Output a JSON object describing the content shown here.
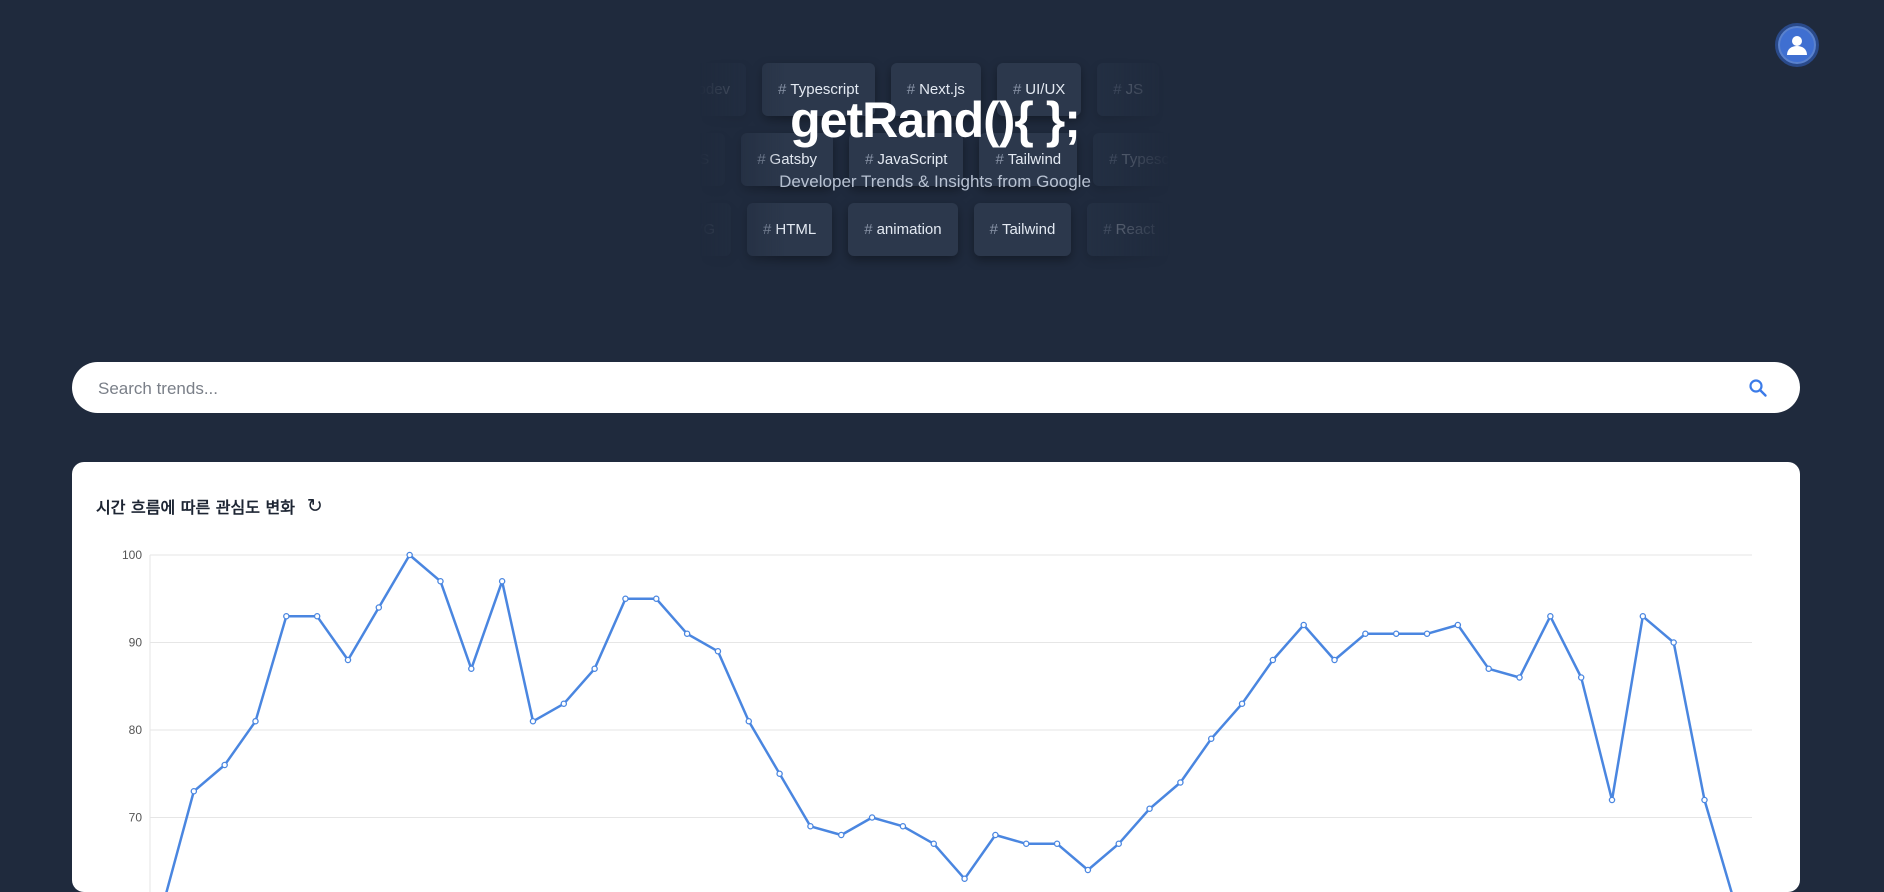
{
  "header": {
    "avatar_icon": "user-icon"
  },
  "hero": {
    "title": "getRand(){ };",
    "subtitle": "Developer Trends & Insights from Google",
    "rows": [
      {
        "offset": -50,
        "tags": [
          "webdev",
          "Typescript",
          "Next.js",
          "UI/UX",
          "JS"
        ]
      },
      {
        "offset": -50,
        "tags": [
          "CSS",
          "Gatsby",
          "JavaScript",
          "Tailwind",
          "Typescript"
        ]
      },
      {
        "offset": -45,
        "tags": [
          "SVG",
          "HTML",
          "animation",
          "Tailwind",
          "React"
        ]
      }
    ]
  },
  "search": {
    "placeholder": "Search trends...",
    "icon": "search-icon"
  },
  "colors": {
    "background": "#1f2a3d",
    "accent": "#4a86e0",
    "card": "#ffffff"
  },
  "chart_card": {
    "title": "시간 흐름에 따른 관심도 변화",
    "refresh_icon": "↻"
  },
  "chart_data": {
    "type": "line",
    "title": "시간 흐름에 따른 관심도 변화",
    "xlabel": "",
    "ylabel": "",
    "y_ticks": [
      100,
      90,
      80,
      70
    ],
    "ylim": [
      60,
      100
    ],
    "grid": true,
    "series": [
      {
        "values": [
          60,
          73,
          76,
          81,
          93,
          93,
          88,
          94,
          100,
          97,
          87,
          97,
          81,
          83,
          87,
          95,
          95,
          91,
          89,
          81,
          75,
          69,
          68,
          70,
          69,
          67,
          63,
          68,
          67,
          67,
          64,
          67,
          71,
          74,
          79,
          83,
          88,
          92,
          88,
          91,
          91,
          91,
          92,
          87,
          86,
          93,
          86,
          72,
          93,
          90,
          72,
          60
        ]
      }
    ]
  }
}
